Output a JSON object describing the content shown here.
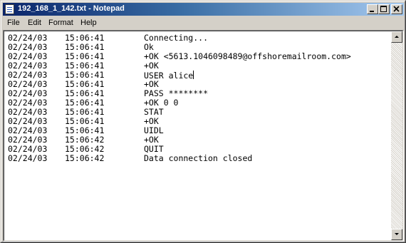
{
  "window": {
    "title": "192_168_1_142.txt - Notepad",
    "icon": "notepad-icon"
  },
  "caption_buttons": [
    "minimize-icon",
    "maximize-icon",
    "close-icon"
  ],
  "menu": [
    "File",
    "Edit",
    "Format",
    "Help"
  ],
  "log": [
    {
      "date": "02/24/03",
      "time": "15:06:41",
      "message": "Connecting..."
    },
    {
      "date": "02/24/03",
      "time": "15:06:41",
      "message": "Ok"
    },
    {
      "date": "02/24/03",
      "time": "15:06:41",
      "message": "+OK <5613.1046098489@offshoremailroom.com>"
    },
    {
      "date": "02/24/03",
      "time": "15:06:41",
      "message": "+OK"
    },
    {
      "date": "02/24/03",
      "time": "15:06:41",
      "message": "USER alice"
    },
    {
      "date": "02/24/03",
      "time": "15:06:41",
      "message": "+OK"
    },
    {
      "date": "02/24/03",
      "time": "15:06:41",
      "message": "PASS ********"
    },
    {
      "date": "02/24/03",
      "time": "15:06:41",
      "message": "+OK 0 0"
    },
    {
      "date": "02/24/03",
      "time": "15:06:41",
      "message": "STAT"
    },
    {
      "date": "02/24/03",
      "time": "15:06:41",
      "message": "+OK"
    },
    {
      "date": "02/24/03",
      "time": "15:06:41",
      "message": "UIDL"
    },
    {
      "date": "02/24/03",
      "time": "15:06:42",
      "message": "+OK"
    },
    {
      "date": "02/24/03",
      "time": "15:06:42",
      "message": "QUIT"
    },
    {
      "date": "02/24/03",
      "time": "15:06:42",
      "message": "Data connection closed"
    }
  ],
  "scrollbar": {
    "up_icon": "scroll-up-arrow-icon",
    "down_icon": "scroll-down-arrow-icon"
  },
  "colors": {
    "titlebar_start": "#0a246a",
    "titlebar_end": "#a6caf0",
    "face": "#d4d0c8"
  }
}
